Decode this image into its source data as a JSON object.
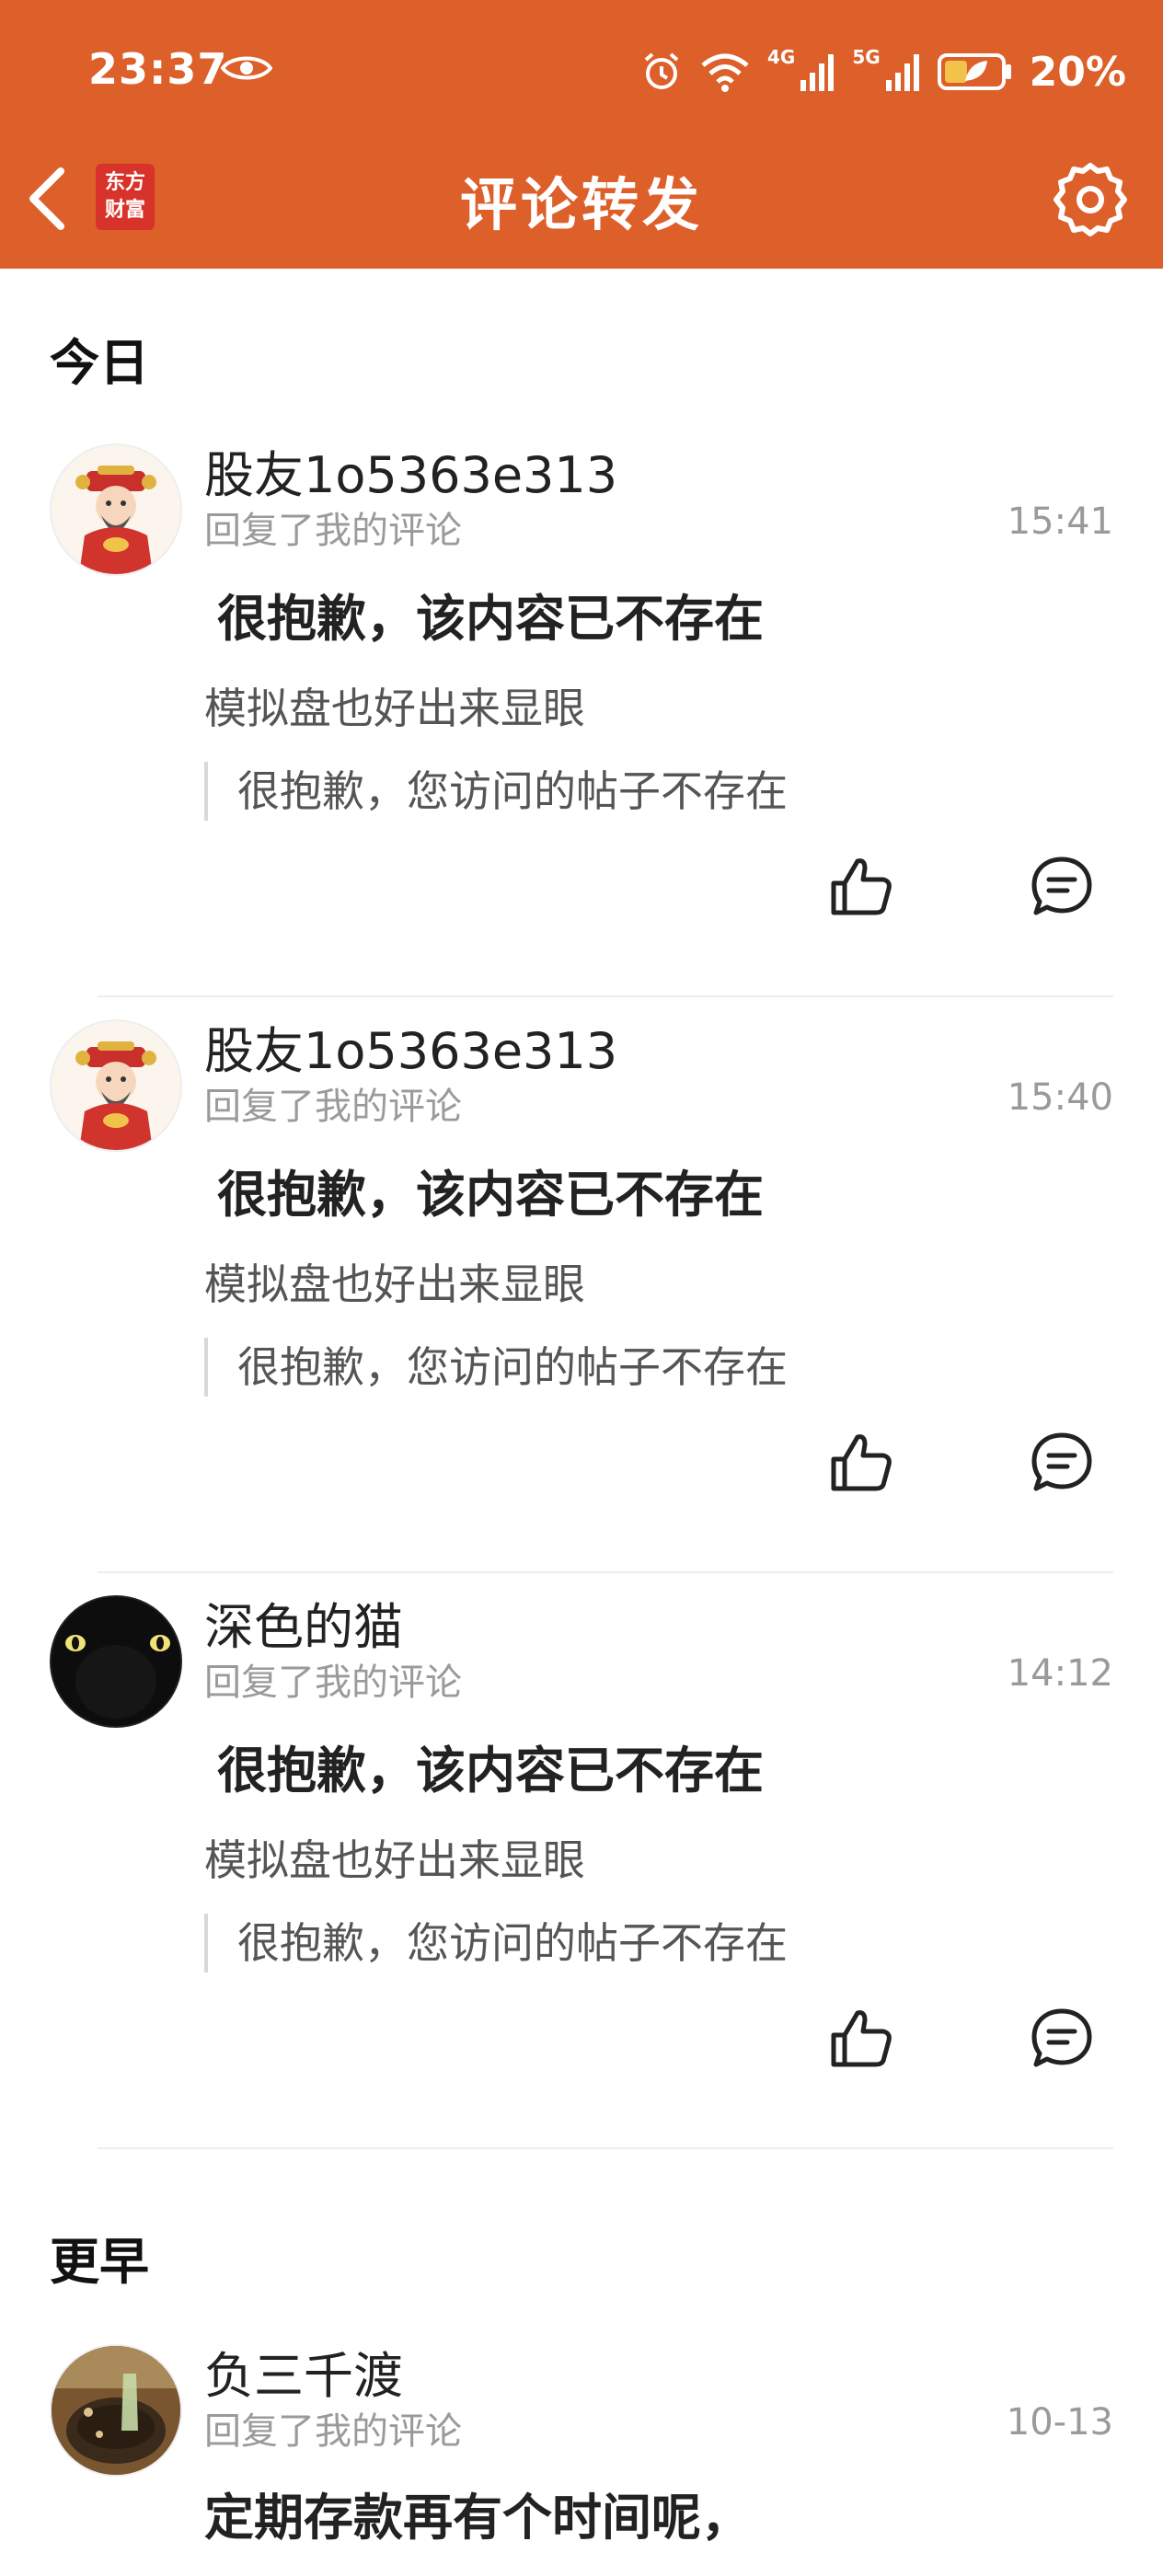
{
  "status_bar": {
    "time": "23:37",
    "battery": "20%",
    "network_4g": "4G",
    "network_5g": "5G"
  },
  "header": {
    "title": "评论转发",
    "logo_line1": "东方",
    "logo_line2": "财富",
    "accent_color": "#dd5f29"
  },
  "sections": [
    {
      "title": "今日",
      "items": [
        {
          "username": "股友1o5363e313",
          "action": "回复了我的评论",
          "time": "15:41",
          "main_text": "很抱歉，该内容已不存在",
          "sub_text": "模拟盘也好出来显眼",
          "quote": "很抱歉，您访问的帖子不存在"
        },
        {
          "username": "股友1o5363e313",
          "action": "回复了我的评论",
          "time": "15:40",
          "main_text": "很抱歉，该内容已不存在",
          "sub_text": "模拟盘也好出来显眼",
          "quote": "很抱歉，您访问的帖子不存在"
        },
        {
          "username": "深色的猫",
          "action": "回复了我的评论",
          "time": "14:12",
          "main_text": "很抱歉，该内容已不存在",
          "sub_text": "模拟盘也好出来显眼",
          "quote": "很抱歉，您访问的帖子不存在"
        }
      ]
    },
    {
      "title": "更早",
      "items": [
        {
          "username": "负三千渡",
          "action": "回复了我的评论",
          "time": "10-13",
          "main_text": "定期存款再有个时间呢，"
        }
      ]
    }
  ],
  "icons": {
    "back": "chevron-left-icon",
    "settings": "gear-icon",
    "like": "thumbs-up-icon",
    "reply": "comment-icon"
  }
}
